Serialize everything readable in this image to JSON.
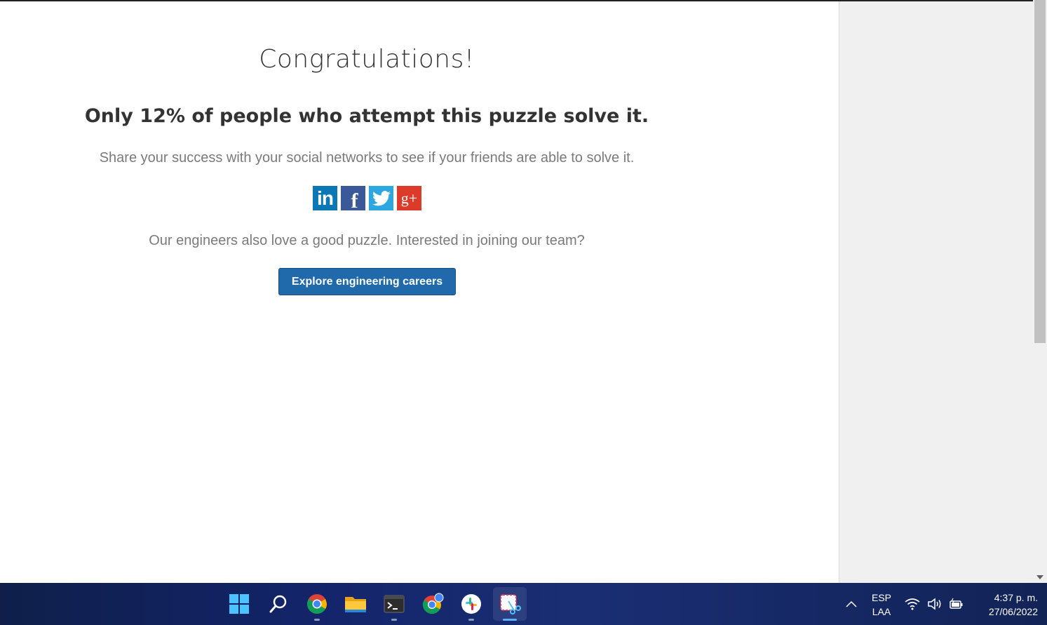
{
  "page": {
    "title": "Congratulations!",
    "subtitle": "Only 12% of people who attempt this puzzle solve it.",
    "share_text": "Share your success with your social networks to see if your friends are able to solve it.",
    "social": [
      {
        "name": "linkedin",
        "glyph": "in",
        "color": "#0b77b5"
      },
      {
        "name": "facebook",
        "glyph": "f",
        "color": "#3b5998"
      },
      {
        "name": "twitter",
        "glyph": "twitter-bird",
        "color": "#2ca7e0"
      },
      {
        "name": "google-plus",
        "glyph": "g+",
        "color": "#dd3b2a"
      }
    ],
    "engineers_text": "Our engineers also love a good puzzle. Interested in joining our team?",
    "careers_button": "Explore engineering careers"
  },
  "taskbar": {
    "apps": [
      "windows-start",
      "search",
      "chrome",
      "file-explorer",
      "terminal",
      "chrome-profile",
      "slack",
      "snipping-tool"
    ],
    "active_app": "snipping-tool",
    "language": {
      "line1": "ESP",
      "line2": "LAA"
    },
    "time": "4:37 p. m.",
    "date": "27/06/2022"
  },
  "colors": {
    "button_bg": "#2069ab",
    "taskbar_bg": "#13246a"
  }
}
